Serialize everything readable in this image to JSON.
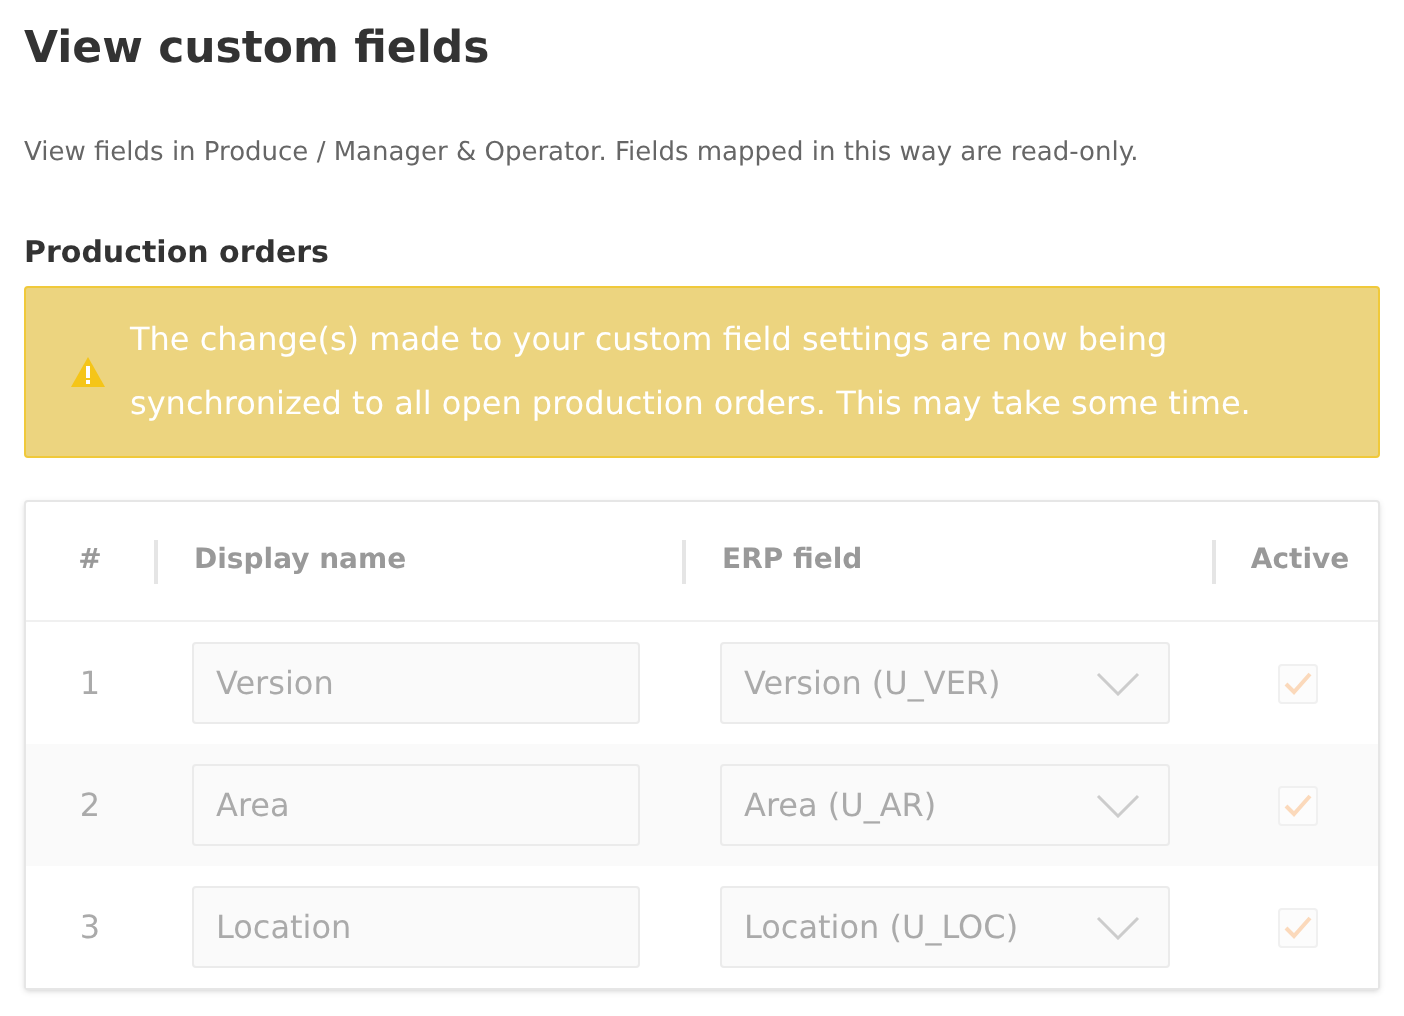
{
  "title": "View custom fields",
  "description": "View fields in Produce / Manager & Operator. Fields mapped in this way are read-only.",
  "section_title": "Production orders",
  "alert": {
    "message": "The change(s) made to your custom field settings are now being synchronized to all open production orders. This may take some time."
  },
  "table": {
    "columns": [
      "#",
      "Display name",
      "ERP field",
      "Active"
    ],
    "rows": [
      {
        "number": "1",
        "display_name": "Version",
        "erp_field": "Version (U_VER)",
        "active": true
      },
      {
        "number": "2",
        "display_name": "Area",
        "erp_field": "Area (U_AR)",
        "active": true
      },
      {
        "number": "3",
        "display_name": "Location",
        "erp_field": "Location (U_LOC)",
        "active": true
      }
    ]
  }
}
